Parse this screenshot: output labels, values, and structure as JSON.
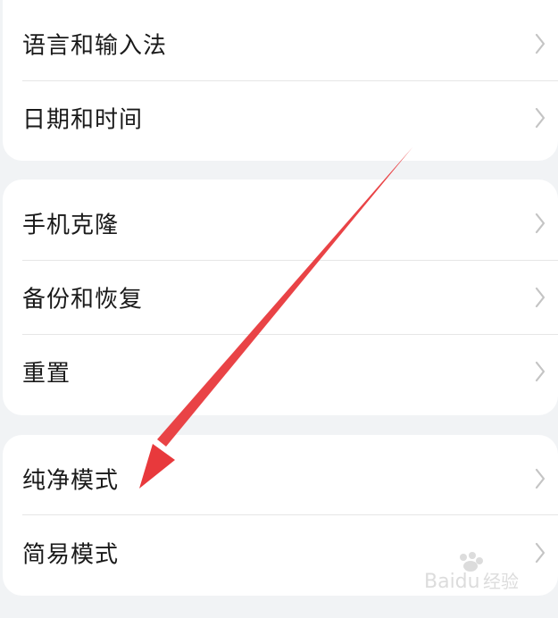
{
  "groups": [
    {
      "items": [
        {
          "label": "语言和输入法"
        },
        {
          "label": "日期和时间"
        }
      ]
    },
    {
      "items": [
        {
          "label": "手机克隆"
        },
        {
          "label": "备份和恢复"
        },
        {
          "label": "重置"
        }
      ]
    },
    {
      "items": [
        {
          "label": "纯净模式"
        },
        {
          "label": "简易模式"
        }
      ]
    }
  ],
  "icons": {
    "row_chevron": "chevron-right-icon"
  },
  "colors": {
    "background": "#f1f3f5",
    "card": "#ffffff",
    "text": "#1a1a1a",
    "chevron": "#c4c4c4",
    "divider": "#e6e6e6",
    "annotation_arrow": "#e8393c"
  },
  "watermark": {
    "text_latin": "Baidu",
    "text_cn": "经验"
  }
}
